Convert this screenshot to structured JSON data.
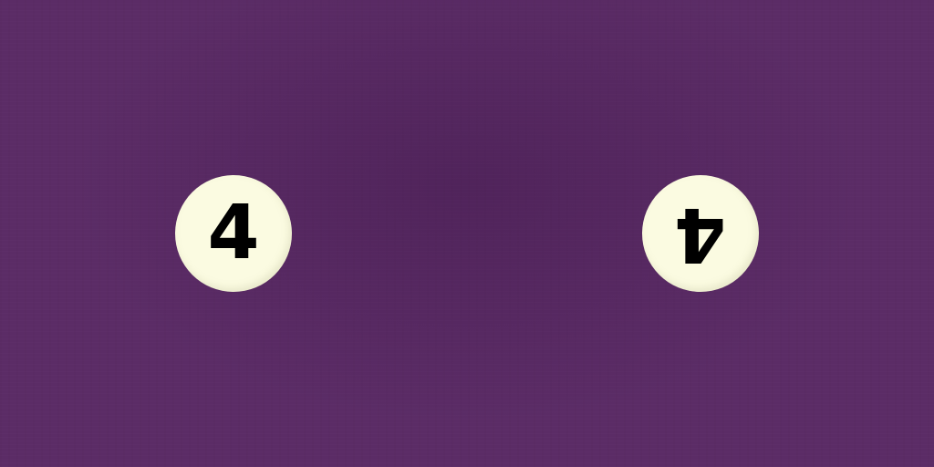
{
  "colors": {
    "background": "#5b2c66",
    "ball": "#fbfbe1",
    "number": "#000000"
  },
  "balls": [
    {
      "number": "4",
      "orientation": "upright"
    },
    {
      "number": "4",
      "orientation": "upside-down"
    }
  ]
}
